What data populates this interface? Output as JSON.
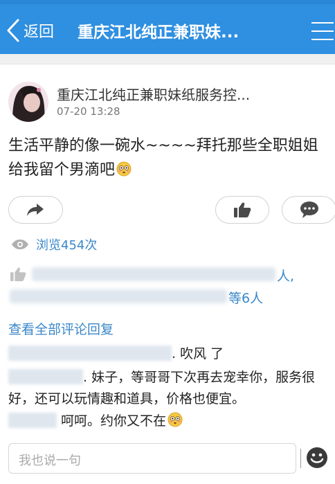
{
  "header": {
    "back_label": "返回",
    "title": "重庆江北纯正兼职妹..."
  },
  "post": {
    "author_name": "重庆江北纯正兼职妹纸服务控...",
    "time": "07-20 13:28",
    "body": "生活平静的像一碗水~~~~拜托那些全职姐姐给我留个男滴吧",
    "emoji": "flushed-face"
  },
  "stats": {
    "views_label": "浏览454次",
    "likes_suffix_1": "人,",
    "likes_suffix_2": "等6人"
  },
  "comments_section": {
    "view_all_label": "查看全部评论回复",
    "comments": [
      {
        "text": ". 吹风 了"
      },
      {
        "text": ". 妹子，等哥哥下次再去宠幸你，服务很好，还可以玩情趣和道具，价格也便宜。"
      },
      {
        "text": "呵呵。约你又不在"
      }
    ]
  },
  "composer": {
    "placeholder": "我也说一句"
  },
  "colors": {
    "header_bg": "#2f8fe0",
    "link_blue": "#3a87c9"
  }
}
